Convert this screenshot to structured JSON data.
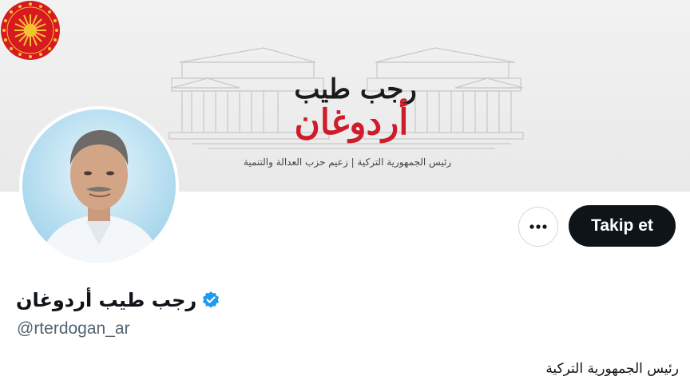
{
  "banner": {
    "name_line1": "رجب طيب",
    "name_line2": "أردوغان",
    "caption": "رئيس الجمهورية التركية | زعيم حزب العدالة والتنمية"
  },
  "profile": {
    "display_name": "رجب طيب أردوغان",
    "handle": "@rterdogan_ar",
    "bio": "رئيس الجمهورية التركية",
    "verified": true
  },
  "actions": {
    "follow_label": "Takip et",
    "more_icon": "more-horizontal-icon"
  },
  "colors": {
    "follow_bg": "#0f1419",
    "verified": "#1d9bf0",
    "seal_red": "#d71920",
    "handle_gray": "#536471"
  }
}
